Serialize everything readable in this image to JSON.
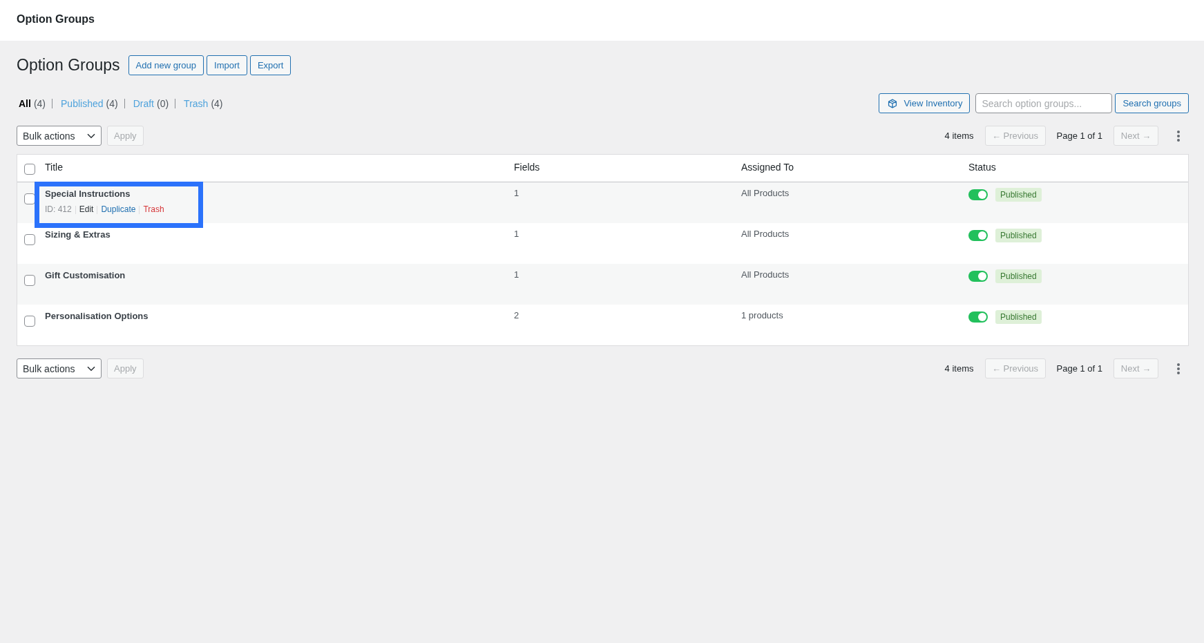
{
  "header": {
    "title": "Option Groups"
  },
  "page": {
    "title": "Option Groups",
    "buttons": [
      "Add new group",
      "Import",
      "Export"
    ]
  },
  "filters": [
    {
      "label": "All",
      "count": "(4)",
      "selected": true
    },
    {
      "label": "Published",
      "count": "(4)",
      "selected": false
    },
    {
      "label": "Draft",
      "count": "(0)",
      "selected": false
    },
    {
      "label": "Trash",
      "count": "(4)",
      "selected": false
    }
  ],
  "toolbar": {
    "inventory_button": "View Inventory",
    "search": {
      "placeholder": "Search option groups..."
    },
    "search_button": "Search groups"
  },
  "top_nav": {
    "bulk_actions": "Bulk actions",
    "apply": {
      "label": "Apply",
      "disabled": true
    },
    "count": "4 items",
    "previous": {
      "label": "← Previous",
      "disabled": true
    },
    "page": "Page 1 of 1",
    "next": {
      "label": "Next →",
      "disabled": true
    }
  },
  "table": {
    "select_all": {
      "checked": false
    },
    "columns": [
      "Title",
      "Fields",
      "Assigned To",
      "Status"
    ],
    "rows": [
      {
        "title": "Special Instructions",
        "checked": false,
        "highlighted": true,
        "actions": [
          {
            "kind": "meta",
            "label": "ID: 412"
          },
          {
            "kind": "link",
            "label": "Edit"
          },
          {
            "kind": "primary",
            "label": "Duplicate"
          },
          {
            "kind": "danger",
            "label": "Trash"
          }
        ],
        "fields": "1",
        "assigned_to": "All Products",
        "status": {
          "on": true,
          "label": "Published"
        }
      },
      {
        "title": "Sizing & Extras",
        "checked": false,
        "highlighted": false,
        "fields": "1",
        "assigned_to": "All Products",
        "status": {
          "on": true,
          "label": "Published"
        }
      },
      {
        "title": "Gift Customisation",
        "checked": false,
        "highlighted": false,
        "fields": "1",
        "assigned_to": "All Products",
        "status": {
          "on": true,
          "label": "Published"
        }
      },
      {
        "title": "Personalisation Options",
        "checked": false,
        "highlighted": false,
        "fields": "2",
        "assigned_to": "1 products",
        "status": {
          "on": true,
          "label": "Published"
        }
      }
    ]
  },
  "bottom_nav": {
    "bulk_actions": "Bulk actions",
    "apply": {
      "label": "Apply",
      "disabled": true
    },
    "count": "4 items",
    "previous": {
      "label": "← Previous",
      "disabled": true
    },
    "page": "Page 1 of 1",
    "next": {
      "label": "Next →",
      "disabled": true
    }
  }
}
